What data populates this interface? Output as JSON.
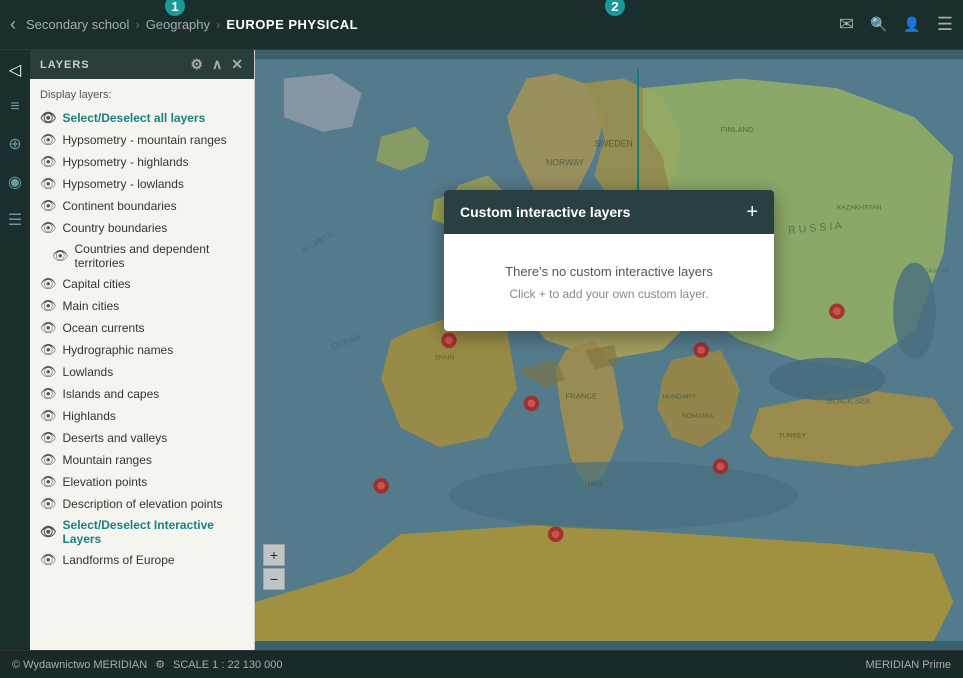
{
  "topbar": {
    "back_label": "‹",
    "breadcrumb": {
      "part1": "Secondary school",
      "sep1": "›",
      "part2": "Geography",
      "sep2": "›",
      "current": "EUROPE PHYSICAL"
    },
    "icons": {
      "mail": "✉",
      "search": "🔍",
      "user": "👤",
      "menu": "☰"
    }
  },
  "sidebar": {
    "header_label": "LAYERS",
    "header_icons": {
      "settings": "⚙",
      "collapse": "∧",
      "close": "✕"
    },
    "display_layers_label": "Display layers:",
    "layers": [
      {
        "id": "select-all",
        "label": "Select/Deselect all layers",
        "type": "selected-all",
        "visible": true
      },
      {
        "id": "hypsometry-mountain",
        "label": "Hypsometry - mountain ranges",
        "visible": true
      },
      {
        "id": "hypsometry-highlands",
        "label": "Hypsometry - highlands",
        "visible": true
      },
      {
        "id": "hypsometry-lowlands",
        "label": "Hypsometry - lowlands",
        "visible": true
      },
      {
        "id": "continent-boundaries",
        "label": "Continent boundaries",
        "visible": true
      },
      {
        "id": "country-boundaries",
        "label": "Country boundaries",
        "visible": true
      },
      {
        "id": "countries-territories",
        "label": "Countries and dependent territories",
        "visible": true,
        "indent": true
      },
      {
        "id": "capital-cities",
        "label": "Capital cities",
        "visible": true
      },
      {
        "id": "main-cities",
        "label": "Main cities",
        "visible": true
      },
      {
        "id": "ocean-currents",
        "label": "Ocean currents",
        "visible": true
      },
      {
        "id": "hydrographic-names",
        "label": "Hydrographic names",
        "visible": true
      },
      {
        "id": "lowlands",
        "label": "Lowlands",
        "visible": true
      },
      {
        "id": "islands-capes",
        "label": "Islands and capes",
        "visible": true
      },
      {
        "id": "highlands",
        "label": "Highlands",
        "visible": true
      },
      {
        "id": "deserts-valleys",
        "label": "Deserts and valleys",
        "visible": true
      },
      {
        "id": "mountain-ranges",
        "label": "Mountain ranges",
        "visible": true
      },
      {
        "id": "elevation-points",
        "label": "Elevation points",
        "visible": true
      },
      {
        "id": "elevation-description",
        "label": "Description of elevation points",
        "visible": true
      },
      {
        "id": "select-interactive",
        "label": "Select/Deselect Interactive Layers",
        "type": "interactive-select",
        "visible": true
      },
      {
        "id": "landforms-europe",
        "label": "Landforms of Europe",
        "visible": true
      }
    ]
  },
  "left_nav": {
    "icons": [
      "◁",
      "≡",
      "📍",
      "🌐",
      "≡"
    ]
  },
  "modal": {
    "title": "Custom interactive layers",
    "plus_btn": "+",
    "no_layers_text": "There's no custom interactive layers",
    "click_hint": "Click + to add your own custom layer."
  },
  "bottombar": {
    "copyright": "© Wydawnictwo MERIDIAN",
    "settings_icon": "⚙",
    "scale_label": "SCALE  1 : 22 130 000",
    "brand": "MERIDIAN Prime"
  },
  "annotations": {
    "badge1": "1",
    "badge2": "2"
  }
}
